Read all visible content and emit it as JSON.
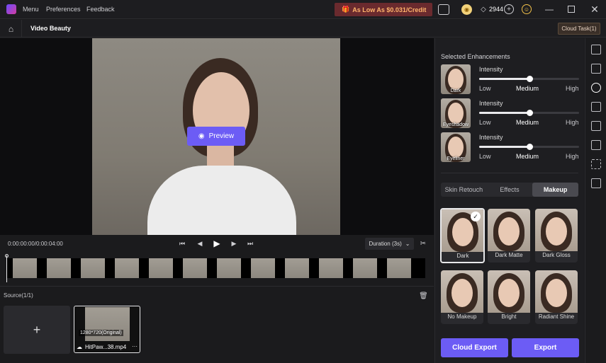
{
  "titlebar": {
    "menu": "Menu",
    "preferences": "Preferences",
    "feedback": "Feedback",
    "promo": "As Low As $0.031/Credit",
    "credits": "2944"
  },
  "subbar": {
    "title": "Video Beauty",
    "cloud_task": "Cloud Task(1)"
  },
  "preview": {
    "button": "Preview"
  },
  "controls": {
    "time": "0:00:00:00/0:00:04:00",
    "duration": "Duration (3s)"
  },
  "source": {
    "title": "Source(1/1)",
    "add": "+",
    "resolution": "1280*720(Original)",
    "filename": "HitPaw...38.mp4",
    "more": "···"
  },
  "panel": {
    "selected_title": "Selected Enhancements",
    "enhancements": [
      {
        "name": "Dark",
        "intensity_label": "Intensity",
        "low": "Low",
        "medium": "Medium",
        "high": "High",
        "level": 0.5
      },
      {
        "name": "Eyeshadow",
        "intensity_label": "Intensity",
        "low": "Low",
        "medium": "Medium",
        "high": "High",
        "level": 0.5
      },
      {
        "name": "Eyeliner",
        "intensity_label": "Intensity",
        "low": "Low",
        "medium": "Medium",
        "high": "High",
        "level": 0.5
      }
    ],
    "tabs": [
      "Skin Retouch",
      "Effects",
      "Makeup"
    ],
    "active_tab": "Makeup",
    "styles": [
      "Dark",
      "Dark Matte",
      "Dark Gloss",
      "No Makeup",
      "Bright",
      "Radiant Shine"
    ],
    "selected_style": "Dark",
    "cloud_export": "Cloud Export",
    "export": "Export"
  },
  "colors": {
    "accent": "#6c5cf5",
    "promo_bg": "#6a2a2e",
    "promo_text": "#ffb46b"
  }
}
